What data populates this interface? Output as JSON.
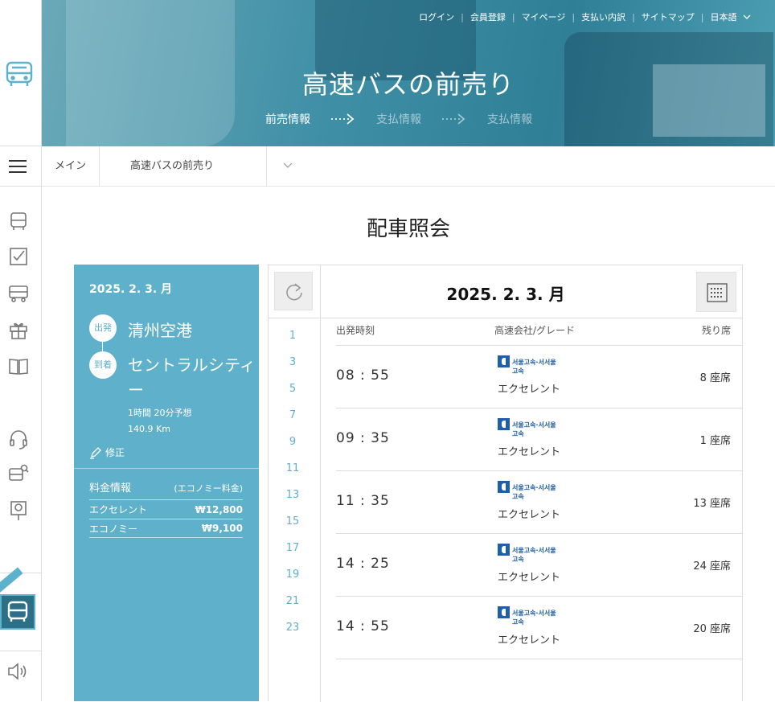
{
  "top_links": [
    "ログイン",
    "会員登録",
    "マイページ",
    "支払い内訳",
    "サイトマップ",
    "日本語"
  ],
  "banner": {
    "title": "高速バスの前売り",
    "steps": [
      "前売情報",
      "支払情報",
      "支払情報"
    ],
    "active_step": 0
  },
  "breadcrumb": {
    "home": "メイン",
    "current": "高速バスの前売り"
  },
  "page_title": "配車照会",
  "info": {
    "date": "2025. 2. 3. 月",
    "departure_badge": "出発",
    "departure": "清州空港",
    "arrival_badge": "到着",
    "arrival": "セントラルシティー",
    "duration": "1時間 20分予想",
    "distance": "140.9 Km",
    "edit_label": "修正",
    "fare_title": "料金情報",
    "fare_note": "(エコノミー料金)",
    "fares": [
      {
        "grade": "エクセレント",
        "amount": "₩12,800"
      },
      {
        "grade": "エコノミー",
        "amount": "₩9,100"
      }
    ]
  },
  "schedule": {
    "date": "2025. 2. 3. 月",
    "hours": [
      "1",
      "3",
      "5",
      "7",
      "9",
      "11",
      "13",
      "15",
      "17",
      "19",
      "21",
      "23"
    ],
    "columns": {
      "time": "出発時刻",
      "company": "高速会社/グレード",
      "seats": "残り席"
    },
    "company_logo_text": "서울고속·서서울고속",
    "rows": [
      {
        "time": "08 : 55",
        "grade": "エクセレント",
        "seats": "8 座席"
      },
      {
        "time": "09 : 35",
        "grade": "エクセレント",
        "seats": "1 座席"
      },
      {
        "time": "11 : 35",
        "grade": "エクセレント",
        "seats": "13 座席"
      },
      {
        "time": "14 : 25",
        "grade": "エクセレント",
        "seats": "24 座席"
      },
      {
        "time": "14 : 55",
        "grade": "エクセレント",
        "seats": "20 座席"
      }
    ]
  },
  "colors": {
    "accent": "#5fb0cb",
    "logo_blue": "#1f5ea8"
  },
  "rail_icons": [
    "bus-icon",
    "checkbox-icon",
    "bus-stop-icon",
    "gift-icon",
    "book-icon",
    "headset-icon",
    "bus-search-icon",
    "location-pin-icon",
    "app-bus-icon",
    "speaker-icon"
  ]
}
